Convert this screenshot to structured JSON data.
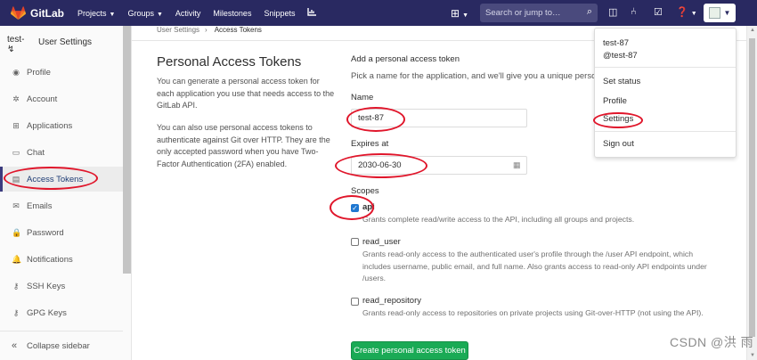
{
  "topbar": {
    "brand": "GitLab",
    "nav": [
      {
        "label": "Projects",
        "caret": true
      },
      {
        "label": "Groups",
        "caret": true
      },
      {
        "label": "Activity",
        "caret": false
      },
      {
        "label": "Milestones",
        "caret": false
      },
      {
        "label": "Snippets",
        "caret": false
      }
    ],
    "search_placeholder": "Search or jump to…",
    "brand_color": "#292961"
  },
  "sidebar": {
    "avatar_text": "test-",
    "title": "User Settings",
    "items": [
      {
        "label": "Profile",
        "icon": "profile-icon",
        "glyph": "◉"
      },
      {
        "label": "Account",
        "icon": "account-icon",
        "glyph": "✲"
      },
      {
        "label": "Applications",
        "icon": "applications-icon",
        "glyph": "⊞"
      },
      {
        "label": "Chat",
        "icon": "chat-icon",
        "glyph": "▭"
      },
      {
        "label": "Access Tokens",
        "icon": "access-tokens-icon",
        "glyph": "▤"
      },
      {
        "label": "Emails",
        "icon": "emails-icon",
        "glyph": "✉"
      },
      {
        "label": "Password",
        "icon": "password-icon",
        "glyph": "🔒"
      },
      {
        "label": "Notifications",
        "icon": "notifications-icon",
        "glyph": "🔔"
      },
      {
        "label": "SSH Keys",
        "icon": "ssh-keys-icon",
        "glyph": "⚷"
      },
      {
        "label": "GPG Keys",
        "icon": "gpg-keys-icon",
        "glyph": "⚷"
      }
    ],
    "active_index": 4,
    "collapse_label": "Collapse sidebar"
  },
  "breadcrumb": {
    "parent": "User Settings",
    "current": "Access Tokens"
  },
  "page": {
    "title": "Personal Access Tokens",
    "desc1": "You can generate a personal access token for each application you use that needs access to the GitLab API.",
    "desc2": "You can also use personal access tokens to authenticate against Git over HTTP. They are the only accepted password when you have Two-Factor Authentication (2FA) enabled."
  },
  "form": {
    "heading": "Add a personal access token",
    "subheading": "Pick a name for the application, and we'll give you a unique persona",
    "name_label": "Name",
    "name_value": "test-87",
    "expires_label": "Expires at",
    "expires_value": "2030-06-30",
    "scopes_label": "Scopes",
    "scopes": [
      {
        "name": "api",
        "checked": true,
        "desc": "Grants complete read/write access to the API, including all groups and projects."
      },
      {
        "name": "read_user",
        "checked": false,
        "desc": "Grants read-only access to the authenticated user's profile through the /user API endpoint, which includes username, public email, and full name. Also grants access to read-only API endpoints under /users."
      },
      {
        "name": "read_repository",
        "checked": false,
        "desc": "Grants read-only access to repositories on private projects using Git-over-HTTP (not using the API)."
      }
    ],
    "submit_label": "Create personal access token"
  },
  "dropdown": {
    "name": "test-87",
    "username": "@test-87",
    "items": [
      "Set status",
      "Profile",
      "Settings",
      "Sign out"
    ]
  },
  "watermark": "CSDN @洪 雨"
}
